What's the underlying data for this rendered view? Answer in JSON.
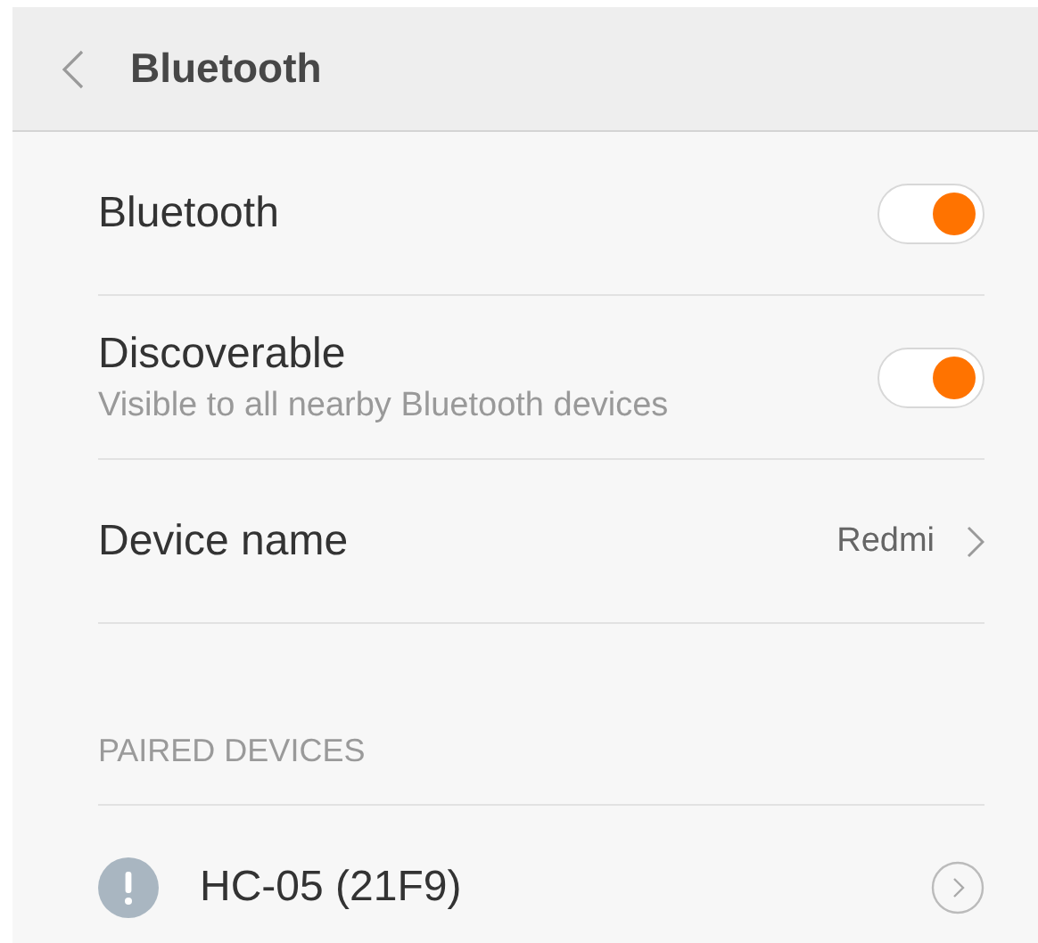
{
  "header": {
    "title": "Bluetooth"
  },
  "settings": [
    {
      "kind": "toggle",
      "label": "Bluetooth",
      "on": true
    },
    {
      "kind": "toggle",
      "label": "Discoverable",
      "subtitle": "Visible to all nearby Bluetooth devices",
      "on": true
    },
    {
      "kind": "link",
      "label": "Device name",
      "value": "Redmi"
    }
  ],
  "paired_devices": {
    "heading": "PAIRED DEVICES",
    "devices": [
      {
        "name": "HC-05 (21F9)"
      }
    ]
  }
}
